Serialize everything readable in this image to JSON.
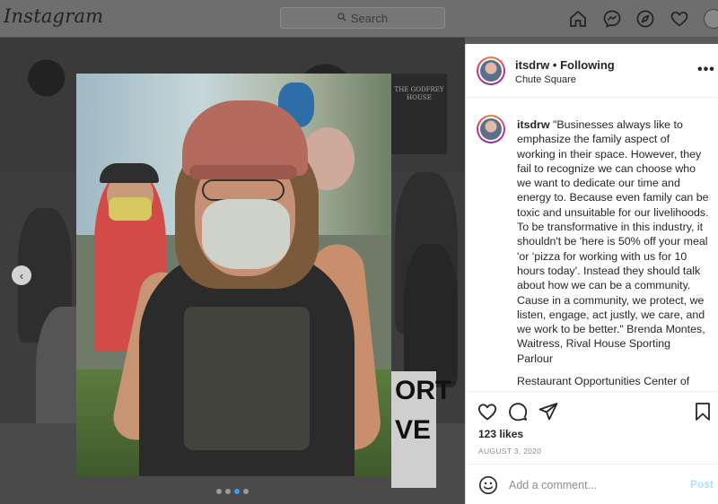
{
  "topbar": {
    "logo": "Instagram",
    "search_placeholder": "Search",
    "icons": [
      "home-icon",
      "messenger-icon",
      "explore-icon",
      "heart-icon",
      "avatar"
    ]
  },
  "backdrop": {
    "sign_text": "THE GODFREY HOUSE",
    "poster_text": "ORT\nVE"
  },
  "carousel": {
    "total": 4,
    "active_index": 2
  },
  "post": {
    "username": "itsdrw",
    "follow_status": "• Following",
    "location": "Chute Square",
    "more": "•••",
    "caption_user": "itsdrw",
    "caption_text": "\"Businesses always like to emphasize the family aspect of working in their space. However, they fail to recognize we can choose who we want to dedicate our time and energy to. Because even family can be toxic and unsuitable for our livelihoods. To be transformative in this industry, it shouldn't be 'here is 50% off your meal 'or 'pizza for working with us for 10 hours today'. Instead they should talk about how we can be a community. Cause in a community, we protect, we listen, engage, act justly, we care, and we work to be better.\" Brenda Montes, Waitress, Rival House Sporting Parlour",
    "caption_more": "Restaurant Opportunities Center of",
    "likes": "123 likes",
    "date": "AUGUST 3, 2020",
    "comment_placeholder": "Add a comment...",
    "post_label": "Post"
  },
  "colors": {
    "accent": "#0095f6",
    "post_disabled": "#b2dffc",
    "dim_overlay": "#6e6e6e"
  }
}
